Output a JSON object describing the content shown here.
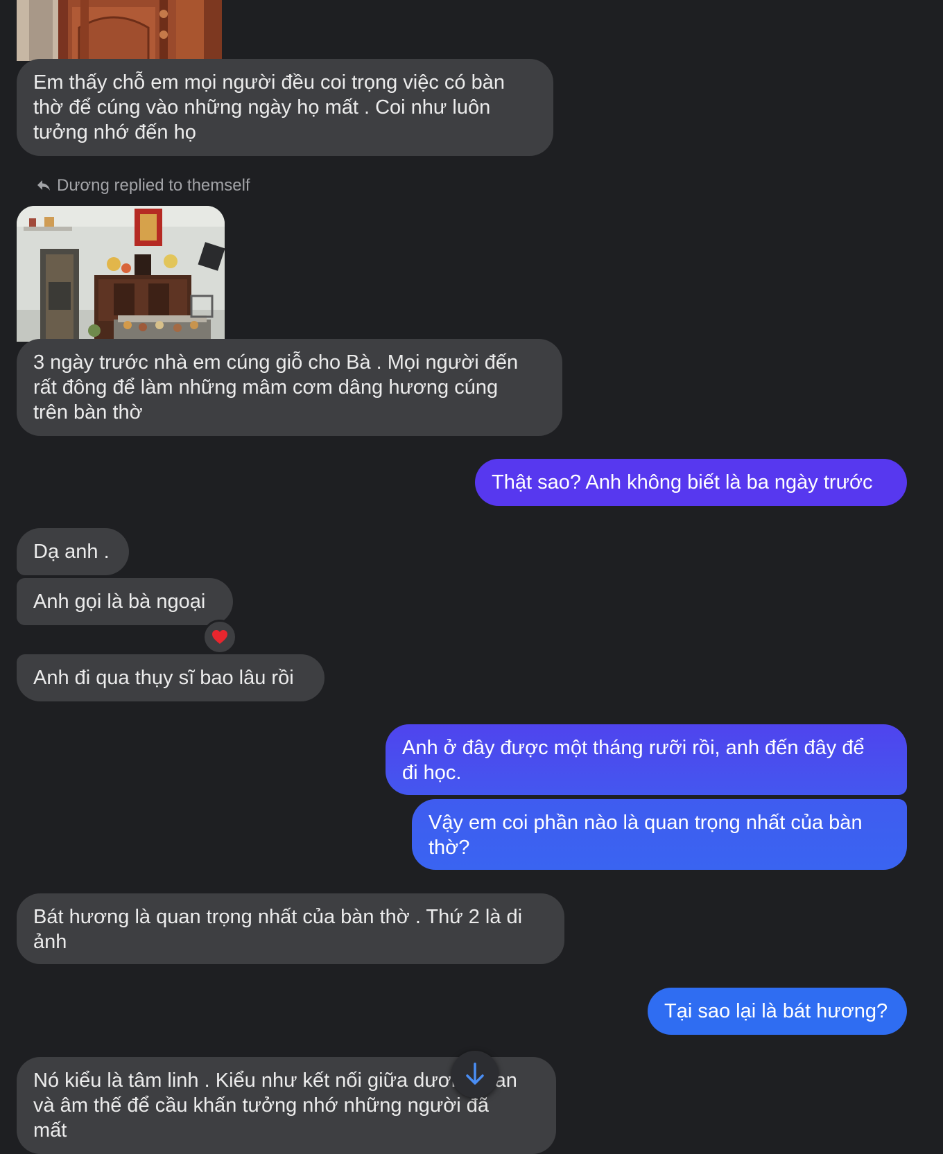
{
  "reply_label": "Dương replied to themself",
  "messages": [
    {
      "text": "Em thấy chỗ em mọi người đều coi trọng việc có bàn\nthờ để cúng vào những ngày họ mất . Coi như luôn\ntưởng nhớ đến họ"
    },
    {
      "text": "3 ngày trước nhà em cúng giỗ cho Bà . Mọi người đến\nrất đông để làm những mâm cơm dâng hương cúng\ntrên bàn thờ"
    },
    {
      "text": "Thật sao? Anh không biết là ba ngày trước"
    },
    {
      "text": "Dạ anh ."
    },
    {
      "text": "Anh gọi là bà ngoại"
    },
    {
      "text": "Anh đi qua thụy sĩ bao lâu rồi"
    },
    {
      "text": "Anh ở đây được một tháng rưỡi rồi, anh đến đây để\nđi học."
    },
    {
      "text": "Vậy em coi phần nào là quan trọng nhất của bàn\nthờ?"
    },
    {
      "text": "Bát hương là quan trọng nhất của bàn thờ . Thứ 2 là di\nảnh"
    },
    {
      "text": "Tại sao lại là bát hương?"
    },
    {
      "text": "Nó kiểu là tâm linh . Kiểu như kết nối giữa dương gian\nvà âm thế để cầu khấn tưởng nhớ những người đã\nmất"
    }
  ],
  "reaction": "❤️",
  "colors": {
    "background": "#1e1f22",
    "incoming_bubble": "#3e3f42",
    "outgoing_top": "#5b3cf0",
    "outgoing_bottom": "#2f6cf2",
    "accent_arrow": "#4a8ef5"
  },
  "icons": [
    "reply-arrow-icon",
    "heart-reaction-icon",
    "scroll-down-arrow-icon"
  ]
}
